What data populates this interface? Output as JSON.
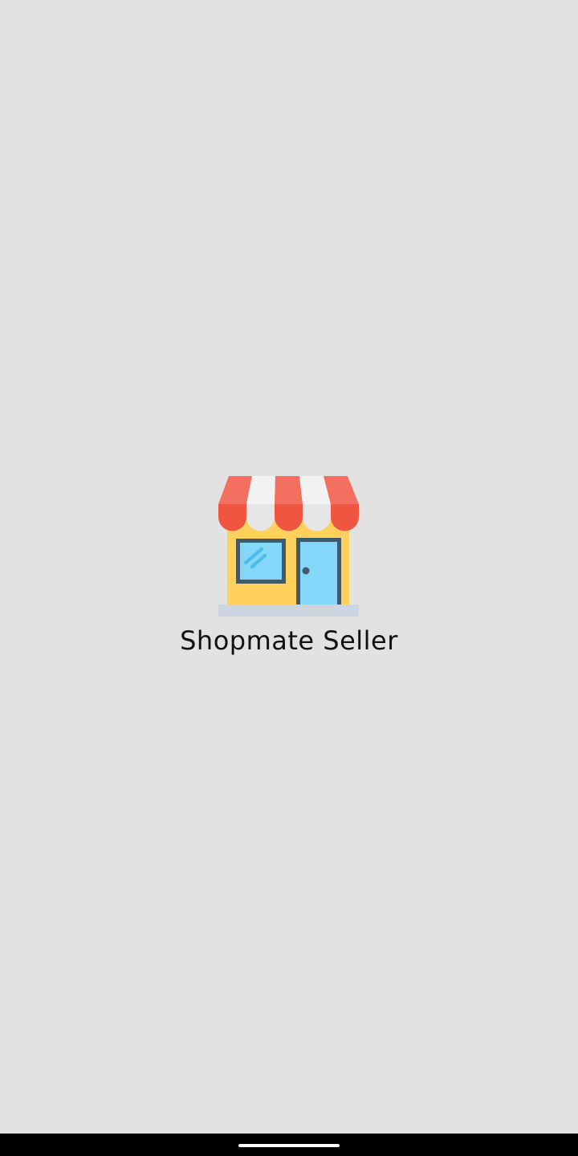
{
  "app": {
    "name": "Shopmate Seller",
    "logo_icon": "storefront-icon"
  },
  "colors": {
    "background": "#e2e2e2",
    "title_text": "#111111",
    "nav_bar": "#000000",
    "home_indicator": "#ffffff",
    "awning_red": "#f05542",
    "awning_red_light": "#f36f5f",
    "awning_white": "#f2f2f2",
    "awning_white_shade": "#e6e6e6",
    "store_wall": "#ffd15c",
    "window_glass": "#84d7f8",
    "window_frame": "#40596b",
    "glass_reflection": "#4cbbe8",
    "store_base": "#cdd6e0"
  },
  "system": {
    "nav_bar_icon": "home-indicator-icon"
  }
}
